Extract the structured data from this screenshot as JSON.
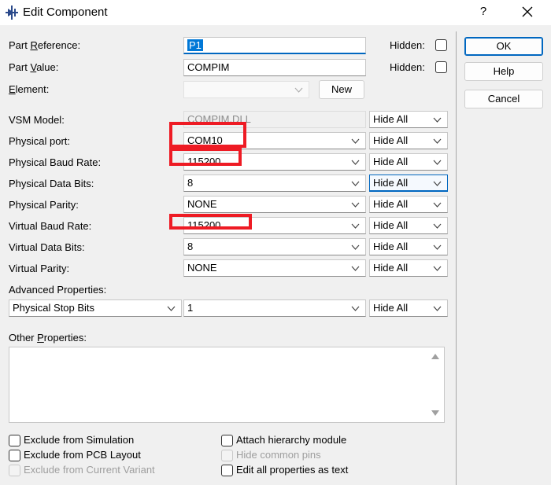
{
  "window": {
    "title": "Edit Component",
    "help_glyph": "?",
    "close_glyph": "✕"
  },
  "labels": {
    "part_reference_prefix": "Part ",
    "part_reference_ul": "R",
    "part_reference_suffix": "eference:",
    "part_value_prefix": "Part ",
    "part_value_ul": "V",
    "part_value_suffix": "alue:",
    "element_ul": "E",
    "element_suffix": "lement:",
    "vsm_model": "VSM Model:",
    "physical_port": "Physical port:",
    "physical_baud_rate": "Physical Baud Rate:",
    "physical_data_bits": "Physical Data Bits:",
    "physical_parity": "Physical Parity:",
    "virtual_baud_rate": "Virtual Baud Rate:",
    "virtual_data_bits": "Virtual Data Bits:",
    "virtual_parity": "Virtual Parity:",
    "advanced_properties": "Advanced Properties:",
    "other_properties_prefix": "Other ",
    "other_properties_ul": "P",
    "other_properties_suffix": "roperties:",
    "hidden": "Hidden:"
  },
  "fields": {
    "part_reference": "P1",
    "part_value": "COMPIM",
    "element": "",
    "vsm_model": "COMPIM.DLL",
    "physical_port": "COM10",
    "physical_baud_rate": "115200",
    "physical_data_bits": "8",
    "physical_parity": "NONE",
    "virtual_baud_rate": "115200",
    "virtual_data_bits": "8",
    "virtual_parity": "NONE",
    "advanced_property": "Physical Stop Bits",
    "advanced_value": "1"
  },
  "visibility_option": "Hide All",
  "buttons": {
    "new": "New",
    "ok": "OK",
    "help": "Help",
    "cancel": "Cancel"
  },
  "checkboxes": {
    "exclude_simulation": "Exclude from Simulation",
    "exclude_pcb": "Exclude from PCB Layout",
    "exclude_variant": "Exclude from Current Variant",
    "attach_hierarchy": "Attach hierarchy module",
    "hide_common_pins": "Hide common pins",
    "edit_all_properties": "Edit all properties as text"
  },
  "colors": {
    "highlight": "#ee1b24",
    "accent": "#0067c0",
    "selection": "#0078d7"
  }
}
